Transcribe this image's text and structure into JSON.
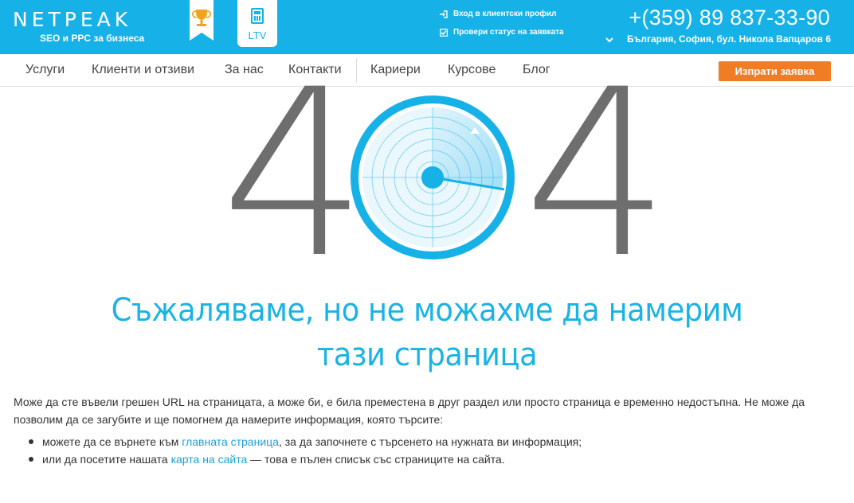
{
  "header": {
    "logo_text": "NETPEAK",
    "logo_tagline": "SEO и PPC за бизнеса",
    "ltv_label": "LTV",
    "login_link": "Вход в клиентски профил",
    "status_link": "Провери статус на заявката",
    "phone": "+(359) 89 837-33-90",
    "address": "България, София, бул. Никола Вапцаров 6"
  },
  "nav": {
    "items": [
      "Услуги",
      "Клиенти и отзиви",
      "За нас",
      "Контакти",
      "Кариери",
      "Курсове",
      "Блог"
    ],
    "cta_label": "Изпрати заявка"
  },
  "error": {
    "digit_left": "4",
    "digit_right": "4",
    "headline": "Съжаляваме, но не можахме да намерим тази страница",
    "paragraph": "Може да сте въвели грешен URL на страницата, а може би, е била преместена в друг раздел или просто страница е временно недостъпна. Не може да позволим да се загубите и ще помогнем да намерите информация, която търсите:",
    "bullet1_pre": "можете да се върнете към ",
    "bullet1_link": "главната страница",
    "bullet1_post": ", за да започнете с търсенето на нужната ви информация;",
    "bullet2_pre": "или да посетите нашата ",
    "bullet2_link": "карта на сайта",
    "bullet2_post": " — това е пълен списък със страниците на сайта."
  },
  "colors": {
    "brand_blue": "#16b1e6",
    "cta_orange": "#f07c24",
    "digit_gray": "#6e6e6e",
    "link_blue": "#1f9fd6"
  },
  "icons": {
    "award": "trophy-ribbon-icon",
    "ltv": "calculator-icon",
    "login": "login-arrow-icon",
    "status": "checkbox-icon",
    "address": "chevron-down-icon",
    "zero": "radar-icon"
  }
}
